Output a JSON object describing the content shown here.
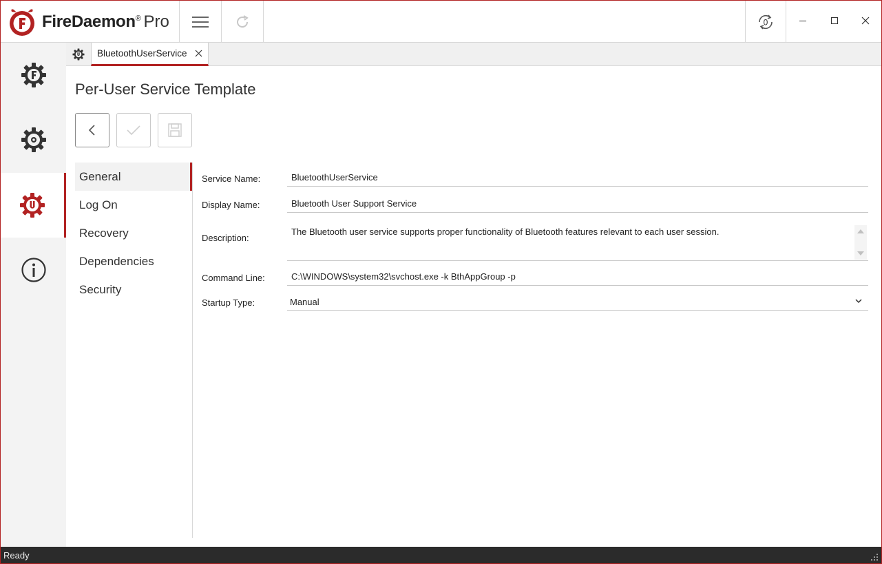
{
  "app": {
    "name": "FireDaemon",
    "registered": "®",
    "edition": "Pro",
    "brand_color": "#b22222"
  },
  "titlebar": {
    "menu_icon": "hamburger-menu-icon",
    "refresh_icon": "refresh-icon",
    "sync_icon": "service-sync-icon",
    "sync_count": "0",
    "window_controls": [
      "minimize",
      "maximize",
      "close"
    ]
  },
  "leftnav": {
    "items": [
      {
        "name": "firedaemon-services",
        "icon": "gear-f-icon"
      },
      {
        "name": "windows-services",
        "icon": "gear-dot-icon"
      },
      {
        "name": "per-user-services",
        "icon": "gear-u-icon",
        "active": true
      },
      {
        "name": "about",
        "icon": "info-icon"
      }
    ]
  },
  "tabs": {
    "home_icon": "gear-u-icon",
    "open": [
      {
        "label": "BluetoothUserService",
        "active": true
      }
    ]
  },
  "page": {
    "title": "Per-User Service Template"
  },
  "actions": {
    "back": "back-icon",
    "apply": "check-icon",
    "save": "save-icon"
  },
  "subnav": {
    "items": [
      {
        "label": "General",
        "active": true
      },
      {
        "label": "Log On"
      },
      {
        "label": "Recovery"
      },
      {
        "label": "Dependencies"
      },
      {
        "label": "Security"
      }
    ]
  },
  "form": {
    "service_name": {
      "label": "Service Name:",
      "value": "BluetoothUserService"
    },
    "display_name": {
      "label": "Display Name:",
      "value": "Bluetooth User Support Service"
    },
    "description": {
      "label": "Description:",
      "value": "The Bluetooth user service supports proper functionality of Bluetooth features relevant to each user session."
    },
    "command_line": {
      "label": "Command Line:",
      "value": "C:\\WINDOWS\\system32\\svchost.exe -k BthAppGroup -p"
    },
    "startup_type": {
      "label": "Startup Type:",
      "value": "Manual"
    }
  },
  "status": {
    "text": "Ready"
  }
}
